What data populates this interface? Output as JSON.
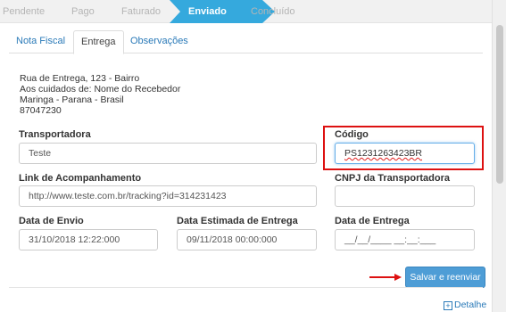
{
  "steps": [
    "Pendente",
    "Pago",
    "Faturado",
    "Enviado",
    "Concluído"
  ],
  "tabs": [
    "Nota Fiscal",
    "Entrega",
    "Observações"
  ],
  "address": [
    "Rua de Entrega, 123 - Bairro",
    "Aos cuidados de: Nome do Recebedor",
    "Maringa - Parana - Brasil",
    "87047230"
  ],
  "form": {
    "transportadora": {
      "label": "Transportadora",
      "value": "Teste"
    },
    "codigo": {
      "label": "Código",
      "value": "PS1231263423BR"
    },
    "link": {
      "label": "Link de Acompanhamento",
      "value": "http://www.teste.com.br/tracking?id=314231423"
    },
    "cnpj": {
      "label": "CNPJ da Transportadora",
      "value": ""
    },
    "data_envio": {
      "label": "Data de Envio",
      "value": "31/10/2018 12:22:000"
    },
    "data_estimada": {
      "label": "Data Estimada de Entrega",
      "value": "09/11/2018 00:00:000"
    },
    "data_entrega": {
      "label": "Data de Entrega",
      "value": "__/__/____ __:__:___"
    }
  },
  "save_button": "Salvar e reenviar",
  "detail_link": "Detalhe",
  "detail_icon": "plus-square-icon",
  "colors": {
    "active_step": "#35a9dd",
    "button": "#4e9dd6",
    "highlight": "#dd1111",
    "link": "#2a7ab8"
  }
}
